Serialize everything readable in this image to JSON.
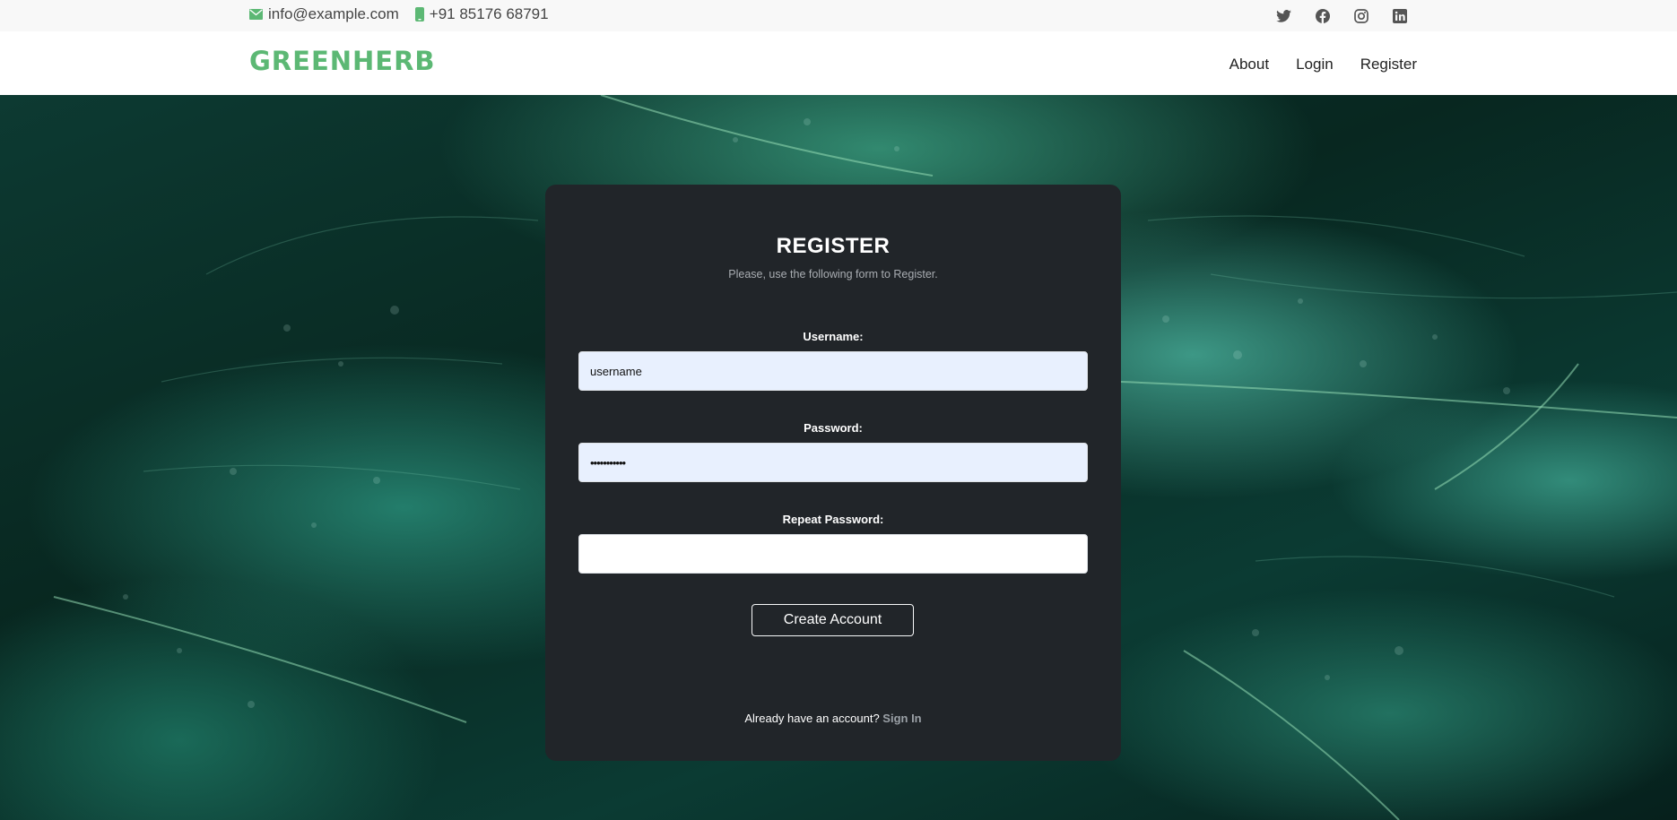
{
  "topbar": {
    "email": "info@example.com",
    "phone": "+91 85176 68791",
    "socials": [
      {
        "icon": "twitter-icon"
      },
      {
        "icon": "facebook-icon"
      },
      {
        "icon": "instagram-icon"
      },
      {
        "icon": "linkedin-icon"
      }
    ]
  },
  "header": {
    "brand": "GREENHERB",
    "nav": {
      "about": "About",
      "login": "Login",
      "register": "Register"
    }
  },
  "form": {
    "title": "REGISTER",
    "subtitle": "Please, use the following form to Register.",
    "username_label": "Username:",
    "username_value": "username",
    "password_label": "Password:",
    "password_value": "•••••••••••",
    "repeat_label": "Repeat Password:",
    "repeat_value": "",
    "submit_label": "Create Account",
    "signin_prompt": "Already have an account?",
    "signin_link": "Sign In"
  },
  "colors": {
    "brand_green": "#5cb874",
    "card_bg": "#212529",
    "autofill_bg": "#e8f0fe"
  }
}
